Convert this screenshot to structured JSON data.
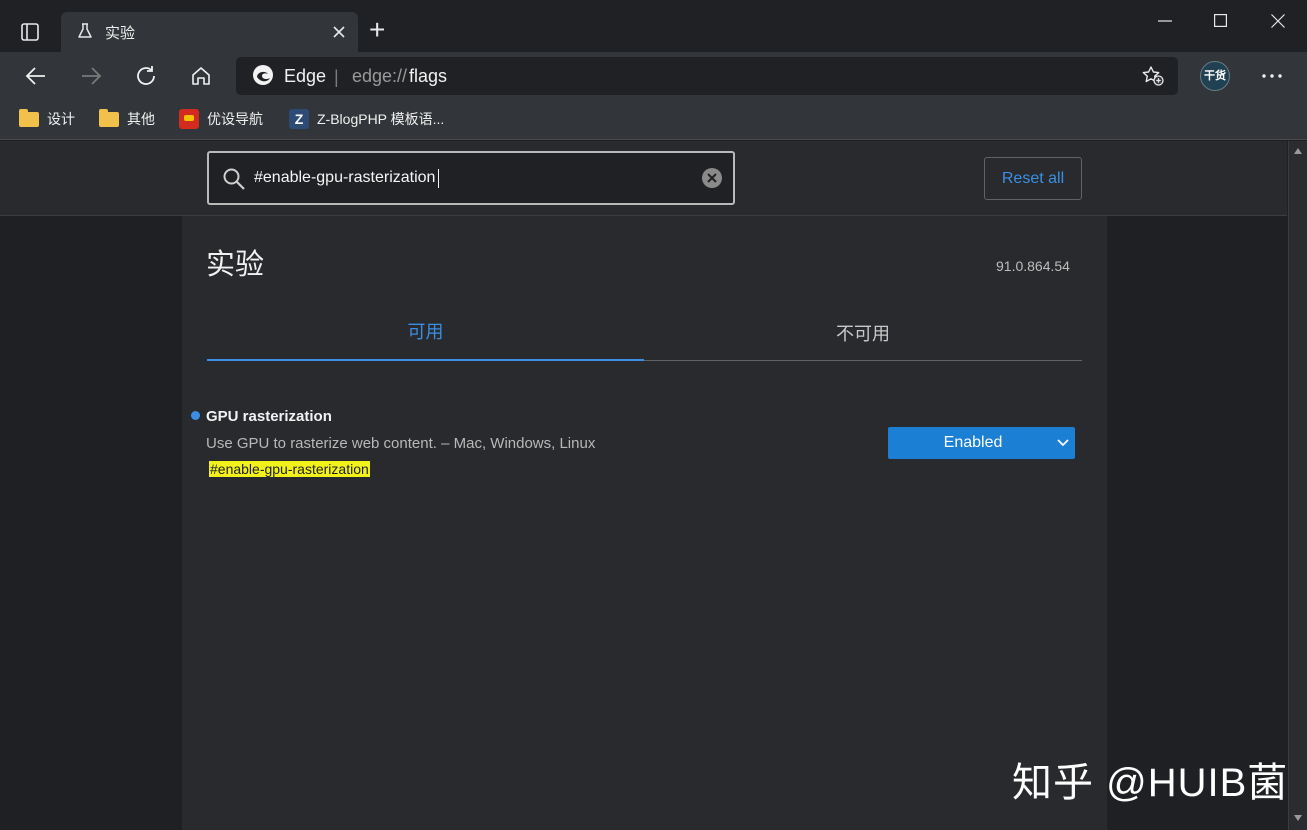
{
  "browser": {
    "tab_title": "实验",
    "new_tab_symbol": "+",
    "address_brand": "Edge",
    "address_separator": "|",
    "url_prefix": "edge://",
    "url_path": "flags",
    "profile_badge": "干货"
  },
  "bookmarks": [
    {
      "label": "设计",
      "icon": "folder-icon"
    },
    {
      "label": "其他",
      "icon": "folder-icon"
    },
    {
      "label": "优设导航",
      "icon": "site-favicon"
    },
    {
      "label": "Z-BlogPHP 模板语...",
      "icon": "z-favicon",
      "icon_letter": "Z"
    }
  ],
  "flags_page": {
    "search_value": "#enable-gpu-rasterization",
    "reset_label": "Reset all",
    "title": "实验",
    "version": "91.0.864.54",
    "tabs": [
      {
        "label": "可用",
        "active": true
      },
      {
        "label": "不可用",
        "active": false
      }
    ],
    "flag": {
      "name": "GPU rasterization",
      "description": "Use GPU to rasterize web content. – Mac, Windows, Linux",
      "anchor": "#enable-gpu-rasterization",
      "selected": "Enabled"
    }
  },
  "watermark": "知乎 @HUIB菌",
  "colors": {
    "accent": "#3a8fe5",
    "select_bg": "#1b7fd4",
    "highlight": "#f2f21a"
  }
}
